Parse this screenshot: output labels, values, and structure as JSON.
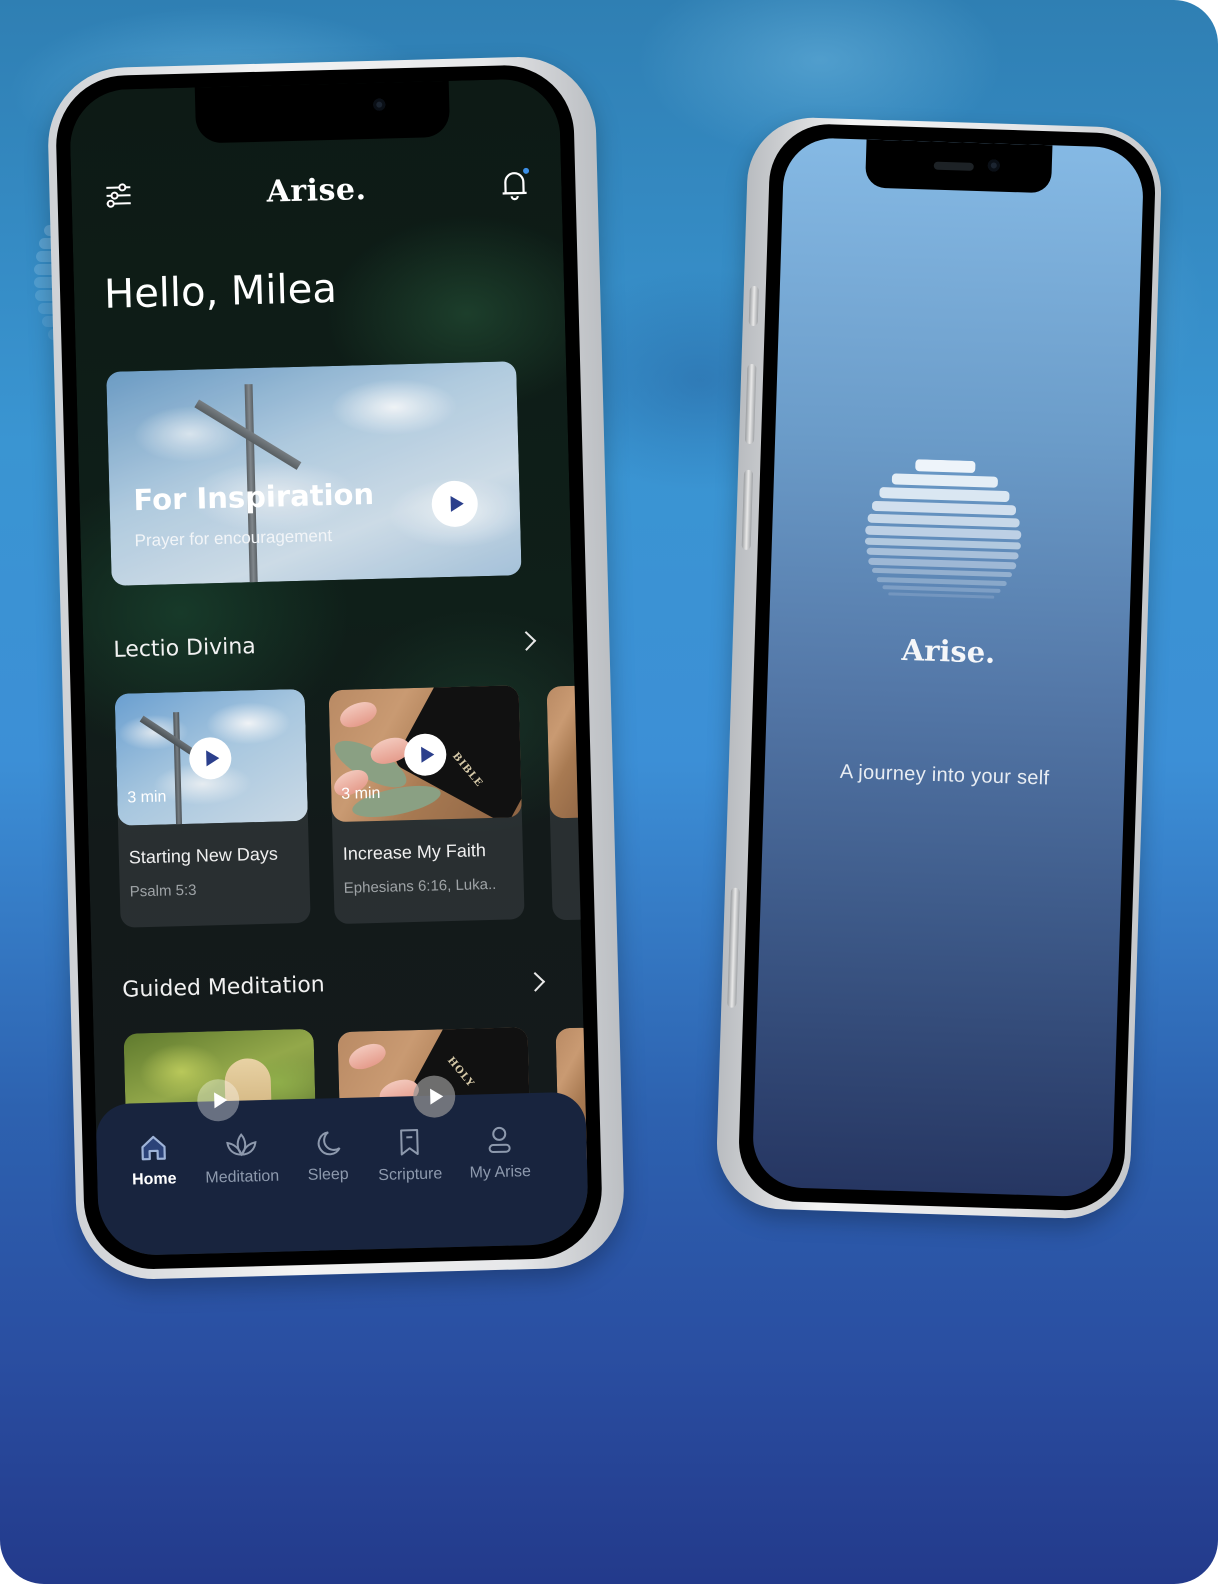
{
  "home_screen": {
    "app_title": "Arise.",
    "greeting": "Hello, Milea",
    "icons": {
      "menu": "sliders-icon",
      "notifications": "bell-icon"
    },
    "notification_dot_color": "#3c8fe6",
    "featured": {
      "title": "For Inspiration",
      "subtitle": "Prayer for encouragement",
      "action": "play-icon"
    },
    "sections": [
      {
        "title": "Lectio Divina",
        "cards": [
          {
            "title": "Starting New Days",
            "subtitle": "Psalm 5:3",
            "duration": "3 min"
          },
          {
            "title": "Increase My Faith",
            "subtitle": "Ephesians 6:16, Luka..",
            "duration": "3 min"
          }
        ]
      },
      {
        "title": "Guided Meditation",
        "cards": [
          {
            "title": "",
            "subtitle": "",
            "duration": ""
          },
          {
            "title": "",
            "subtitle": "",
            "duration": ""
          }
        ]
      }
    ],
    "tabbar": [
      {
        "label": "Home",
        "icon": "home-icon",
        "active": true
      },
      {
        "label": "Meditation",
        "icon": "lotus-icon",
        "active": false
      },
      {
        "label": "Sleep",
        "icon": "moon-icon",
        "active": false
      },
      {
        "label": "Scripture",
        "icon": "bookmark-icon",
        "active": false
      },
      {
        "label": "My Arise",
        "icon": "user-icon",
        "active": false
      }
    ],
    "accent_color": "#2b3f8c",
    "tabbar_color": "#18243e"
  },
  "splash_screen": {
    "app_title": "Arise.",
    "tagline": "A journey into your self",
    "logo": "striped-sun-icon"
  },
  "book_label": "BIBLE",
  "book_label_2": "HOLY"
}
